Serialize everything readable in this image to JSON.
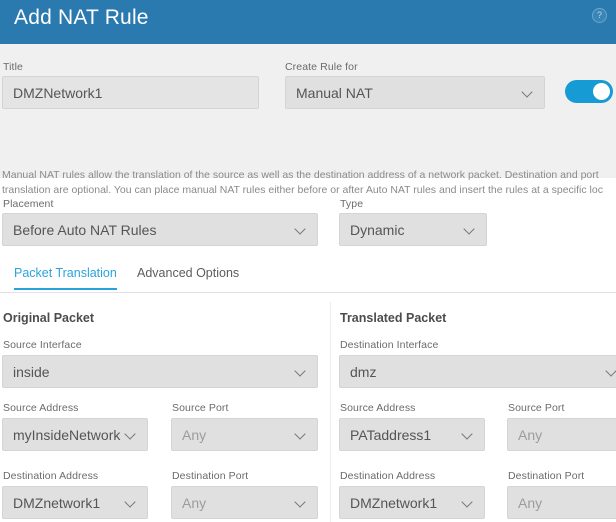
{
  "header": {
    "title": "Add NAT Rule",
    "help_icon": "question-mark-circle-icon",
    "background": "#2a7ab0"
  },
  "top": {
    "title_label": "Title",
    "title_value": "DMZNetwork1",
    "create_rule_for_label": "Create Rule for",
    "create_rule_for_value": "Manual NAT",
    "enable_toggle_state": "on",
    "description": "Manual NAT rules allow the translation of the source as well as the destination address of a network packet. Destination and port\ntranslation are optional. You can place manual NAT rules either before or after Auto NAT rules and insert the rules at a specific loc"
  },
  "rule_options": {
    "placement_label": "Placement",
    "placement_value": "Before Auto NAT Rules",
    "type_label": "Type",
    "type_value": "Dynamic"
  },
  "tabs": [
    {
      "label": "Packet Translation",
      "active": true
    },
    {
      "label": "Advanced Options",
      "active": false
    }
  ],
  "original_packet": {
    "section_title": "Original Packet",
    "source_interface_label": "Source Interface",
    "source_interface_value": "inside",
    "source_address_label": "Source Address",
    "source_address_value": "myInsideNetwork",
    "source_port_label": "Source Port",
    "source_port_value": "Any",
    "destination_address_label": "Destination Address",
    "destination_address_value": "DMZnetwork1",
    "destination_port_label": "Destination Port",
    "destination_port_value": "Any"
  },
  "translated_packet": {
    "section_title": "Translated Packet",
    "destination_interface_label": "Destination Interface",
    "destination_interface_value": "dmz",
    "source_address_label": "Source Address",
    "source_address_value": "PATaddress1",
    "source_port_label": "Source Port",
    "source_port_value": "Any",
    "destination_address_label": "Destination Address",
    "destination_address_value": "DMZnetwork1",
    "destination_port_label": "Destination Port",
    "destination_port_value": "Any"
  },
  "colors": {
    "header_blue": "#2a7ab0",
    "accent_blue": "#29a3dd",
    "toggle_blue": "#169bd5",
    "panel_gray": "#f0f0f0",
    "field_gray": "#e0e0e0"
  }
}
